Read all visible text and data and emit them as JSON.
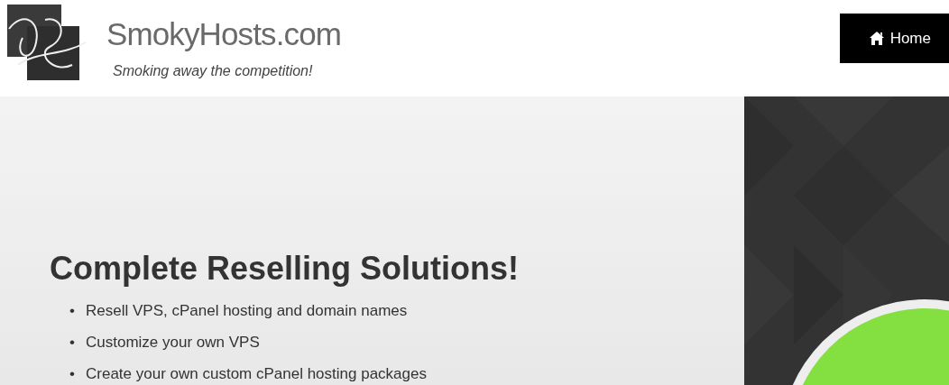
{
  "header": {
    "brand": "SmokyHosts.com",
    "tagline": "Smoking away the competition!",
    "nav": [
      {
        "label": "Home",
        "selected": true
      }
    ]
  },
  "hero": {
    "heading": "Complete Reselling Solutions!",
    "features": [
      {
        "bullet": "•",
        "text": "Resell VPS, cPanel hosting and domain names"
      },
      {
        "bullet": "•",
        "text": "Customize your own VPS"
      },
      {
        "bullet": "•",
        "text": "Create your own custom cPanel hosting packages"
      }
    ]
  }
}
